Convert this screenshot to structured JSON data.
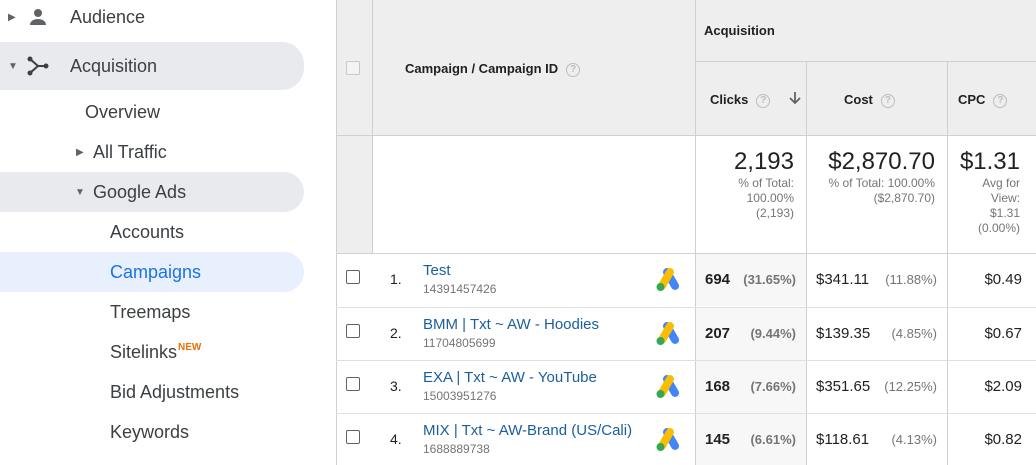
{
  "sidebar": {
    "audience": "Audience",
    "acquisition": "Acquisition",
    "overview": "Overview",
    "all_traffic": "All Traffic",
    "google_ads": "Google Ads",
    "accounts": "Accounts",
    "campaigns": "Campaigns",
    "treemaps": "Treemaps",
    "sitelinks": "Sitelinks",
    "sitelinks_badge": "NEW",
    "bid_adjustments": "Bid Adjustments",
    "keywords": "Keywords"
  },
  "table": {
    "group_header": "Acquisition",
    "dimension_header": "Campaign / Campaign ID",
    "columns": {
      "clicks": "Clicks",
      "cost": "Cost",
      "cpc": "CPC"
    },
    "totals": {
      "clicks": "2,193",
      "clicks_sub1": "% of Total:",
      "clicks_sub2": "100.00%",
      "clicks_sub3": "(2,193)",
      "cost": "$2,870.70",
      "cost_sub1": "% of Total: 100.00%",
      "cost_sub2": "($2,870.70)",
      "cpc": "$1.31",
      "cpc_sub1": "Avg for",
      "cpc_sub2": "View:",
      "cpc_sub3": "$1.31",
      "cpc_sub4": "(0.00%)"
    },
    "rows": [
      {
        "num": "1.",
        "name": "Test",
        "id": "14391457426",
        "clicks": "694",
        "clicks_pct": "(31.65%)",
        "cost": "$341.11",
        "cost_pct": "(11.88%)",
        "cpc": "$0.49"
      },
      {
        "num": "2.",
        "name": "BMM | Txt ~ AW - Hoodies",
        "id": "11704805699",
        "clicks": "207",
        "clicks_pct": "(9.44%)",
        "cost": "$139.35",
        "cost_pct": "(4.85%)",
        "cpc": "$0.67"
      },
      {
        "num": "3.",
        "name": "EXA | Txt ~ AW - YouTube",
        "id": "15003951276",
        "clicks": "168",
        "clicks_pct": "(7.66%)",
        "cost": "$351.65",
        "cost_pct": "(12.25%)",
        "cpc": "$2.09"
      },
      {
        "num": "4.",
        "name": "MIX | Txt ~ AW-Brand (US/Cali)",
        "id": "1688889738",
        "clicks": "145",
        "clicks_pct": "(6.61%)",
        "cost": "$118.61",
        "cost_pct": "(4.13%)",
        "cpc": "$0.82"
      }
    ]
  },
  "colors": {
    "active_text": "#1a73e8",
    "active_bg": "#e8f0fe",
    "link": "#1a5e9e",
    "new_badge": "#e8710a"
  },
  "icons": [
    "person-icon",
    "acquisition-icon",
    "google-ads-icon",
    "help-icon",
    "sort-arrow-down-icon"
  ]
}
